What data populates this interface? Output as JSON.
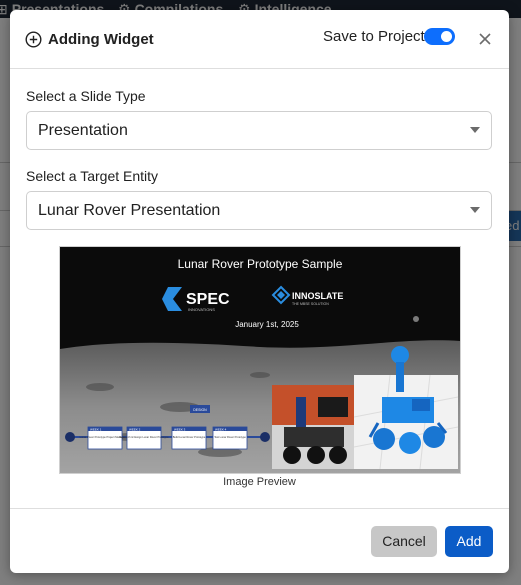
{
  "background": {
    "tabs": [
      {
        "label": "Presentations",
        "icon": "presentation-icon"
      },
      {
        "label": "Compilations",
        "icon": "compilations-icon"
      },
      {
        "label": "Intelligence",
        "icon": "gear-icon"
      }
    ],
    "right_button_fragment": "ed"
  },
  "modal": {
    "title": "Adding Widget",
    "save_to_project_label": "Save to Project",
    "save_to_project_enabled": true,
    "slide_type": {
      "label": "Select a Slide Type",
      "value": "Presentation"
    },
    "target_entity": {
      "label": "Select a Target Entity",
      "value": "Lunar Rover Presentation"
    },
    "preview": {
      "caption": "Image Preview",
      "slide_title": "Lunar Rover Prototype Sample",
      "logo_spec": "SPEC",
      "logo_spec_sub": "INNOVATIONS",
      "logo_innoslate": "INNOSLATE",
      "logo_innoslate_sub": "THE MBSE SOLUTION",
      "date": "January 1st, 2025",
      "timeline": [
        {
          "week": "WEEK 1",
          "text": "Lunar Rover Prototype Project Management"
        },
        {
          "week": "WEEK 2",
          "text": "Research & Design Lunar Rover Prototype"
        },
        {
          "week": "WEEK 3",
          "text": "Build Lunar Rover Prototype"
        },
        {
          "week": "WEEK 4",
          "text": "Test Lunar Rover Prototype"
        }
      ],
      "timeline_tag": "DESIGN"
    },
    "buttons": {
      "cancel": "Cancel",
      "add": "Add"
    }
  },
  "colors": {
    "primary": "#0b5cc7",
    "toggle": "#0d6efd",
    "cancel_bg": "#c7c7c7"
  }
}
